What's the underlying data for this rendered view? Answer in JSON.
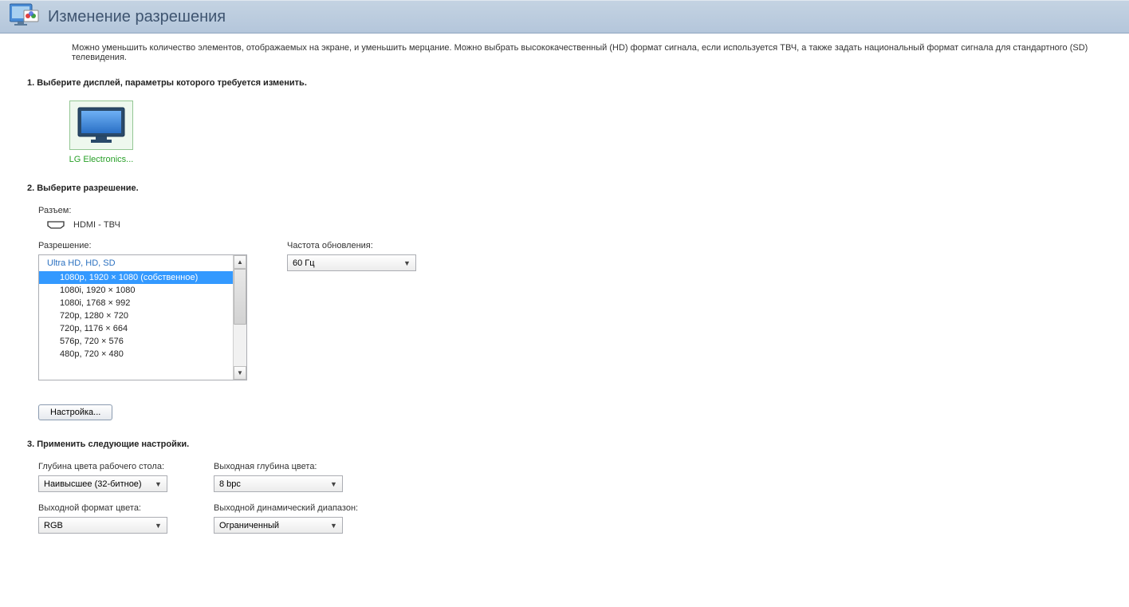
{
  "header": {
    "title": "Изменение разрешения"
  },
  "description": "Можно уменьшить количество элементов, отображаемых на экране, и уменьшить мерцание. Можно выбрать высококачественный (HD) формат сигнала, если используется ТВЧ, а также задать национальный формат сигнала для стандартного (SD) телевидения.",
  "step1": {
    "title": "1. Выберите дисплей, параметры которого требуется изменить.",
    "display_label": "LG Electronics..."
  },
  "step2": {
    "title": "2. Выберите разрешение.",
    "connector_label": "Разъем:",
    "connector_value": "HDMI - ТВЧ",
    "resolution_label": "Разрешение:",
    "refresh_label": "Частота обновления:",
    "refresh_value": "60 Гц",
    "list_group": "Ultra HD, HD, SD",
    "list_items": [
      "1080p, 1920 × 1080 (собственное)",
      "1080i, 1920 × 1080",
      "1080i, 1768 × 992",
      "720p, 1280 × 720",
      "720p, 1176 × 664",
      "576p, 720 × 576",
      "480p, 720 × 480"
    ],
    "customize_button": "Настройка..."
  },
  "step3": {
    "title": "3. Применить следующие настройки.",
    "color_depth_label": "Глубина цвета рабочего стола:",
    "color_depth_value": "Наивысшее (32-битное)",
    "output_depth_label": "Выходная глубина цвета:",
    "output_depth_value": "8 bpc",
    "color_format_label": "Выходной формат цвета:",
    "color_format_value": "RGB",
    "dynamic_range_label": "Выходной динамический диапазон:",
    "dynamic_range_value": "Ограниченный"
  }
}
